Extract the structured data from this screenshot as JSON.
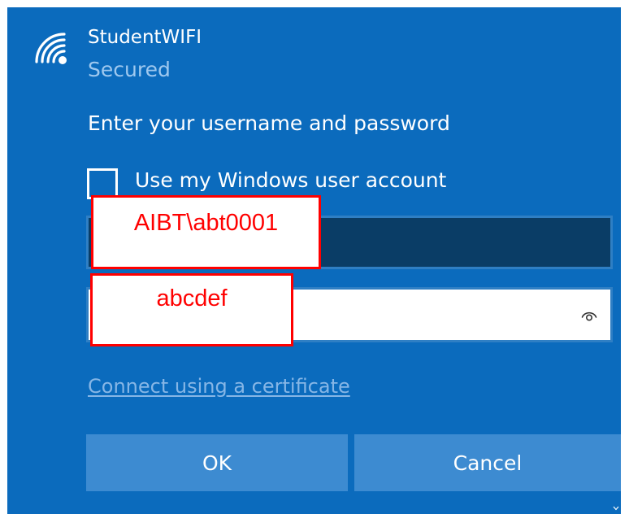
{
  "network": {
    "name": "StudentWIFI",
    "status": "Secured",
    "icon": "wifi-signal-icon"
  },
  "prompt": "Enter your username and password",
  "use_windows_account": {
    "label": "Use my Windows user account",
    "checked": false
  },
  "username": {
    "value": "",
    "annotation": "AIBT\\abt0001"
  },
  "password": {
    "value": "",
    "annotation": "abcdef",
    "reveal_icon": "eye-icon"
  },
  "certificate_link": "Connect using a certificate",
  "buttons": {
    "ok": "OK",
    "cancel": "Cancel"
  },
  "colors": {
    "flyout_bg": "#0b6bbd",
    "button_bg": "#3d8bd1",
    "username_bg": "#0a3d66",
    "annotation": "#ff0000",
    "link": "#86b6e6"
  }
}
